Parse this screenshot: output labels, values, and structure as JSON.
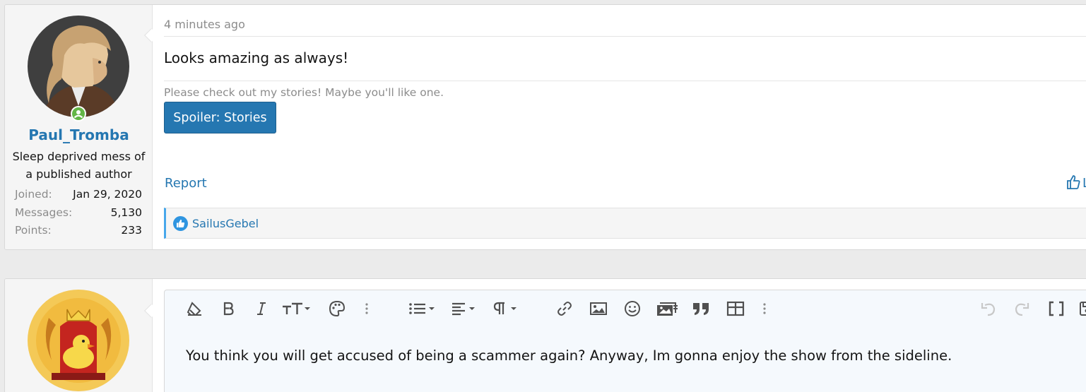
{
  "post1": {
    "username": "Paul_Tromba",
    "user_title": "Sleep deprived mess of a published author",
    "stats": [
      {
        "label": "Joined:",
        "value": "Jan 29, 2020"
      },
      {
        "label": "Messages:",
        "value": "5,130"
      },
      {
        "label": "Points:",
        "value": "233"
      }
    ],
    "time": "4 minutes ago",
    "body": "Looks amazing as always!",
    "signature": "Please check out my stories! Maybe you'll like one.",
    "spoiler_label": "Spoiler: Stories",
    "report_label": "Report",
    "like_label": "L",
    "reaction_user": "SailusGebel"
  },
  "reply": {
    "text": "You think you will get accused of being a scammer again? Anyway, Im gonna enjoy the show from the sideline.",
    "toolbar_icons": [
      "eraser-icon",
      "bold-icon",
      "italic-icon",
      "text-size-icon",
      "palette-icon",
      "more-vertical-icon",
      "list-icon",
      "align-icon",
      "paragraph-icon",
      "link-icon",
      "image-icon",
      "smilie-icon",
      "media-icon",
      "quote-icon",
      "table-icon",
      "more-vertical-icon",
      "undo-icon",
      "redo-icon",
      "bbcode-icon",
      "drafts-icon"
    ]
  },
  "colors": {
    "accent": "#2577b1",
    "reaction_border": "#47a7eb",
    "muted": "#8c8c8c",
    "online": "#63b646"
  }
}
